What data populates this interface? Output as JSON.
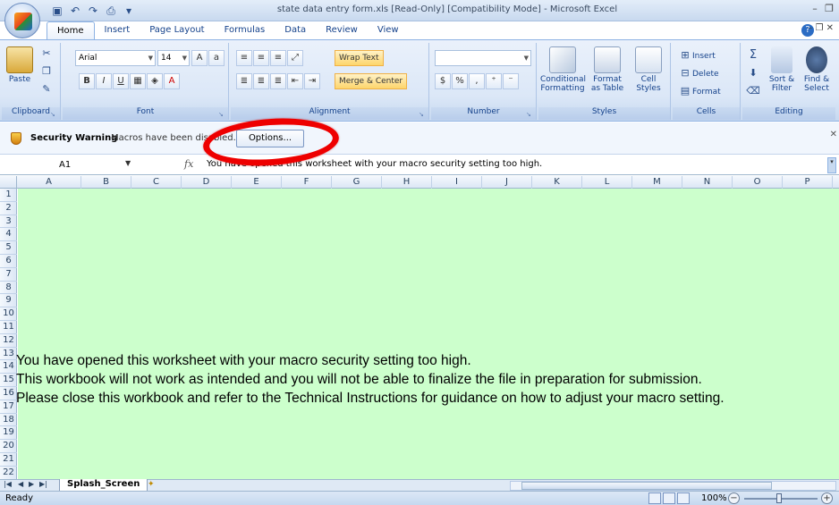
{
  "window": {
    "title": "state data entry form.xls [Read-Only] [Compatibility Mode] - Microsoft Excel",
    "qat_icons": [
      "save-icon",
      "undo-icon",
      "redo-icon",
      "print-preview-icon",
      "customize-qat-icon"
    ]
  },
  "tabs": [
    "Home",
    "Insert",
    "Page Layout",
    "Formulas",
    "Data",
    "Review",
    "View"
  ],
  "active_tab": "Home",
  "ribbon": {
    "clipboard": {
      "paste": "Paste",
      "label": "Clipboard"
    },
    "font": {
      "name": "Arial",
      "size": "14",
      "label": "Font"
    },
    "alignment": {
      "wrap_text": "Wrap Text",
      "merge_center": "Merge & Center",
      "label": "Alignment"
    },
    "number": {
      "format": "",
      "currency": "$",
      "percent": "%",
      "comma": ",",
      "label": "Number"
    },
    "styles": {
      "conditional": "Conditional",
      "conditional2": "Formatting",
      "format_table": "Format",
      "format_table2": "as Table",
      "cell_styles": "Cell",
      "cell_styles2": "Styles",
      "label": "Styles"
    },
    "cells": {
      "insert": "Insert",
      "delete": "Delete",
      "format": "Format",
      "label": "Cells"
    },
    "editing": {
      "sum": "Σ",
      "sort": "Sort &",
      "sort2": "Filter",
      "find": "Find &",
      "find2": "Select",
      "label": "Editing"
    }
  },
  "security_bar": {
    "label": "Security Warning",
    "message": "Macros have been disabled.",
    "options_button": "Options..."
  },
  "formula_bar": {
    "name_box": "A1",
    "fx": "fx",
    "content": "You have opened this worksheet with your macro security setting too high."
  },
  "columns": [
    "A",
    "B",
    "C",
    "D",
    "E",
    "F",
    "G",
    "H",
    "I",
    "J",
    "K",
    "L",
    "M",
    "N",
    "O",
    "P"
  ],
  "rows": [
    "1",
    "2",
    "3",
    "4",
    "5",
    "6",
    "7",
    "8",
    "9",
    "10",
    "11",
    "12",
    "13",
    "14",
    "15",
    "16",
    "17",
    "18",
    "19",
    "20",
    "21",
    "22"
  ],
  "sheet_messages": [
    "You have opened this worksheet with your macro security setting too high.",
    "This workbook will not work as intended and you will not be able to finalize the file in preparation for submission.",
    "Please close this workbook and refer to the Technical Instructions for guidance on how to adjust your macro setting."
  ],
  "sheet_background": "#ccffcc",
  "sheet_tab": "Splash_Screen",
  "status": {
    "text": "Ready",
    "zoom": "100%"
  },
  "annotation_color": "#ee0000"
}
